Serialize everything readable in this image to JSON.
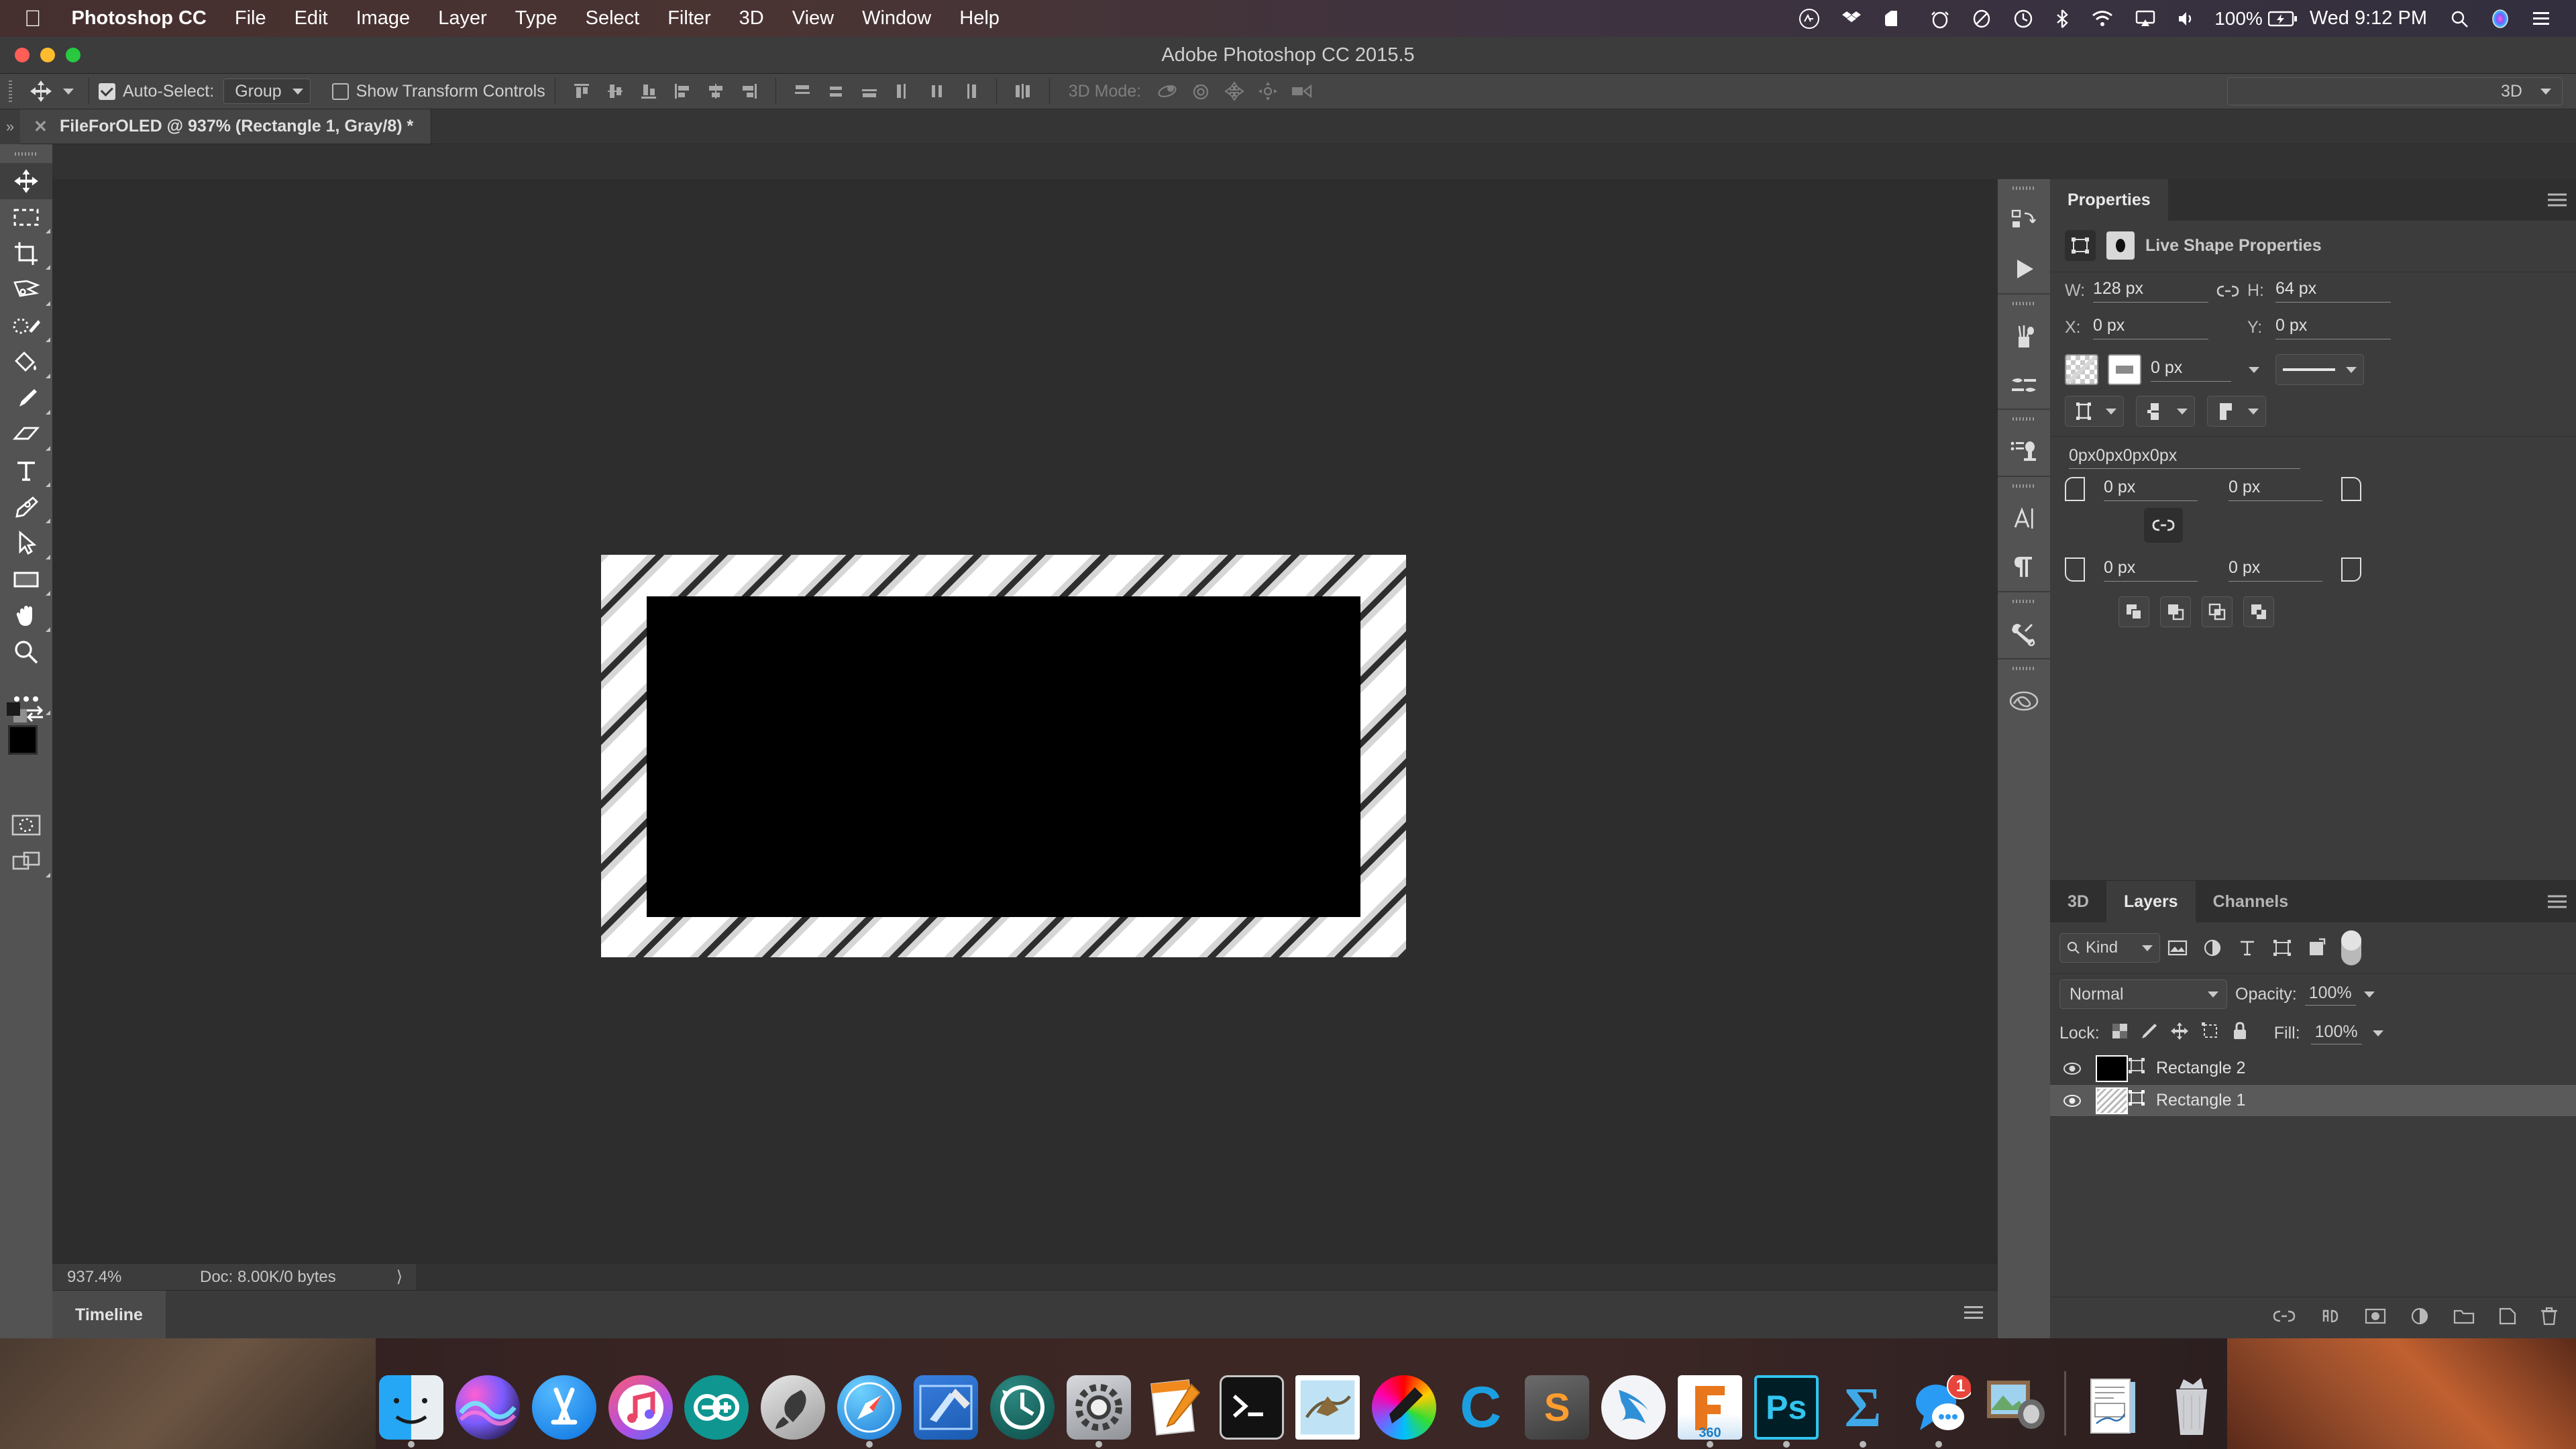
{
  "menubar": {
    "apple_icon": "apple-icon",
    "app_name": "Photoshop CC",
    "items": [
      "File",
      "Edit",
      "Image",
      "Layer",
      "Type",
      "Select",
      "Filter",
      "3D",
      "View",
      "Window",
      "Help"
    ],
    "status": {
      "creative_cloud": "creative-cloud-icon",
      "dropbox": "dropbox-icon",
      "evernote": "evernote-icon",
      "alarm": "alarm-icon",
      "backblaze": "backblaze-icon",
      "timemachine": "time-machine-icon",
      "bluetooth": "bluetooth-icon",
      "wifi": "wifi-icon",
      "airplay": "airplay-icon",
      "volume": "volume-icon",
      "battery_percent": "100%",
      "battery": "battery-charging-icon",
      "datetime": "Wed 9:12 PM",
      "spotlight": "search-icon",
      "siri": "siri-icon",
      "notification_center": "notification-center-icon"
    }
  },
  "window": {
    "title": "Adobe Photoshop CC 2015.5"
  },
  "options_bar": {
    "move_tool_icon": "move-tool-icon",
    "auto_select_label": "Auto-Select:",
    "auto_select_checked": true,
    "auto_select_value": "Group",
    "show_transform_label": "Show Transform Controls",
    "show_transform_checked": false,
    "align_icons": [
      "align-top-edges-icon",
      "align-vertical-centers-icon",
      "align-bottom-edges-icon",
      "align-left-edges-icon",
      "align-horizontal-centers-icon",
      "align-right-edges-icon"
    ],
    "distribute_icons": [
      "distribute-top-edges-icon",
      "distribute-vertical-centers-icon",
      "distribute-bottom-edges-icon",
      "distribute-left-edges-icon",
      "distribute-horizontal-centers-icon",
      "distribute-right-edges-icon"
    ],
    "extra_icon": "align-extra-icon",
    "mode3d_label": "3D Mode:",
    "mode3d_icons": [
      "rotate-3d-icon",
      "roll-3d-icon",
      "drag-3d-icon",
      "slide-3d-icon",
      "scale-3d-icon"
    ],
    "workspace": "3D"
  },
  "document_tab": {
    "close_icon": "close-icon",
    "title": "FileForOLED @ 937% (Rectangle 1, Gray/8) *"
  },
  "toolbar": {
    "tools": [
      {
        "name": "move-tool",
        "icon": "move-tool-icon",
        "selected": true,
        "has_flyout": false
      },
      {
        "name": "rectangular-marquee-tool",
        "icon": "marquee-icon",
        "selected": false,
        "has_flyout": true
      },
      {
        "name": "crop-tool",
        "icon": "crop-icon",
        "selected": false,
        "has_flyout": true
      },
      {
        "name": "lasso-tool",
        "icon": "lasso-icon",
        "selected": false,
        "has_flyout": true
      },
      {
        "name": "quick-selection-tool",
        "icon": "quick-select-icon",
        "selected": false,
        "has_flyout": true
      },
      {
        "name": "paint-bucket-tool",
        "icon": "paint-bucket-icon",
        "selected": false,
        "has_flyout": true
      },
      {
        "name": "brush-tool",
        "icon": "brush-icon",
        "selected": false,
        "has_flyout": true
      },
      {
        "name": "eraser-tool",
        "icon": "eraser-icon",
        "selected": false,
        "has_flyout": true
      },
      {
        "name": "type-tool",
        "icon": "type-icon",
        "selected": false,
        "has_flyout": true
      },
      {
        "name": "pen-tool",
        "icon": "pen-icon",
        "selected": false,
        "has_flyout": true
      },
      {
        "name": "path-selection-tool",
        "icon": "path-select-icon",
        "selected": false,
        "has_flyout": true
      },
      {
        "name": "rectangle-tool",
        "icon": "rectangle-icon",
        "selected": false,
        "has_flyout": true
      },
      {
        "name": "hand-tool",
        "icon": "hand-icon",
        "selected": false,
        "has_flyout": true
      },
      {
        "name": "zoom-tool",
        "icon": "zoom-icon",
        "selected": false,
        "has_flyout": false
      },
      {
        "name": "edit-toolbar",
        "icon": "ellipsis-icon",
        "selected": false,
        "has_flyout": true
      }
    ],
    "foreground_color": "#000000",
    "background_color": "#ffffff",
    "default-colors-icon": "default-colors-icon",
    "swap-colors-icon": "swap-colors-icon",
    "quick-mask-icon": "quick-mask-icon",
    "screen-mode-icon": "screen-mode-icon"
  },
  "canvas": {
    "zoom": "937.4%",
    "doc_info": "Doc: 8.00K/0 bytes",
    "expand_icon": "chevron-right-icon",
    "pattern": "diagonal-stripe-pattern",
    "shape_color": "#000000"
  },
  "timeline": {
    "tab_label": "Timeline",
    "menu_icon": "panel-menu-icon"
  },
  "icon_rail": {
    "groups": [
      [
        "history-panel-icon",
        "actions-panel-icon"
      ],
      [
        "brushes-panel-icon",
        "brush-settings-panel-icon"
      ],
      [
        "clone-source-panel-icon"
      ],
      [
        "character-panel-icon",
        "paragraph-panel-icon"
      ],
      [
        "tool-presets-panel-icon"
      ],
      [
        "cc-libraries-panel-icon"
      ]
    ]
  },
  "properties": {
    "tab_label": "Properties",
    "menu_icon": "panel-menu-icon",
    "shape_icon": "live-shape-icon",
    "mask_icon": "mask-thumbnail-icon",
    "heading": "Live Shape Properties",
    "w_label": "W:",
    "w_value": "128 px",
    "link_icon": "link-icon",
    "h_label": "H:",
    "h_value": "64 px",
    "x_label": "X:",
    "x_value": "0 px",
    "y_label": "Y:",
    "y_value": "0 px",
    "fill_swatch": "no-fill-swatch",
    "stroke_swatch": "white-stroke-swatch",
    "stroke_width": "0 px",
    "stroke_style_icon": "stroke-style-icon",
    "stroke_align_icon": "stroke-align-icon",
    "stroke_cap_icon": "stroke-cap-icon",
    "stroke_corner_icon": "stroke-corner-icon",
    "radius_summary": "0px0px0px0px",
    "radius_tl": "0 px",
    "radius_tr": "0 px",
    "radius_bl": "0 px",
    "radius_br": "0 px",
    "radius_link_icon": "link-icon",
    "path_ops": [
      "combine-shapes-icon",
      "subtract-front-shape-icon",
      "intersect-shapes-icon",
      "exclude-overlap-icon"
    ]
  },
  "layers": {
    "tabs": [
      {
        "label": "3D",
        "active": false
      },
      {
        "label": "Layers",
        "active": true
      },
      {
        "label": "Channels",
        "active": false
      }
    ],
    "menu_icon": "panel-menu-icon",
    "filter_label": "Kind",
    "filter_icons": [
      "filter-pixel-icon",
      "filter-adjustment-icon",
      "filter-type-icon",
      "filter-shape-icon",
      "filter-smart-object-icon"
    ],
    "filter_toggle": "filter-enable-toggle",
    "blend_mode": "Normal",
    "opacity_label": "Opacity:",
    "opacity_value": "100%",
    "lock_label": "Lock:",
    "lock_icons": [
      "lock-transparent-pixels-icon",
      "lock-image-pixels-icon",
      "lock-position-icon",
      "lock-artboard-icon",
      "lock-all-icon"
    ],
    "fill_label": "Fill:",
    "fill_value": "100%",
    "rows": [
      {
        "name": "Rectangle 2",
        "visible": true,
        "selected": false,
        "thumb": "black"
      },
      {
        "name": "Rectangle 1",
        "visible": true,
        "selected": true,
        "thumb": "hatch"
      }
    ],
    "footer_icons": [
      "link-layers-icon",
      "layer-style-icon",
      "layer-mask-icon",
      "adjustment-layer-icon",
      "new-group-icon",
      "new-layer-icon",
      "delete-layer-icon"
    ]
  },
  "dock": {
    "items": [
      {
        "name": "finder",
        "label": "Finder",
        "running": true
      },
      {
        "name": "siri",
        "label": "Siri",
        "running": false
      },
      {
        "name": "app-store",
        "label": "App Store",
        "running": false
      },
      {
        "name": "itunes",
        "label": "iTunes",
        "running": false
      },
      {
        "name": "arduino",
        "label": "Arduino",
        "running": false
      },
      {
        "name": "launchpad",
        "label": "Launchpad",
        "running": false
      },
      {
        "name": "safari",
        "label": "Safari",
        "running": true
      },
      {
        "name": "xcode",
        "label": "Xcode",
        "running": false
      },
      {
        "name": "time-machine",
        "label": "Time Machine",
        "running": false
      },
      {
        "name": "system-preferences",
        "label": "System Preferences",
        "running": true
      },
      {
        "name": "pages",
        "label": "Pages",
        "running": false
      },
      {
        "name": "terminal",
        "label": "Terminal",
        "running": false
      },
      {
        "name": "mail",
        "label": "Mail",
        "running": false
      },
      {
        "name": "digital-color-meter",
        "label": "Digital Color Meter",
        "running": false
      },
      {
        "name": "cura",
        "label": "C",
        "running": false
      },
      {
        "name": "sublime-text",
        "label": "S",
        "running": false
      },
      {
        "name": "swift",
        "label": "Swift",
        "running": false
      },
      {
        "name": "fusion-360",
        "label": "360",
        "running": true
      },
      {
        "name": "photoshop",
        "label": "Ps",
        "running": true
      },
      {
        "name": "latex",
        "label": "LaTeX",
        "running": true
      },
      {
        "name": "messages",
        "label": "Messages",
        "badge": "1",
        "running": true
      },
      {
        "name": "preview",
        "label": "Preview",
        "running": false
      },
      {
        "name": "documents-stack",
        "label": "Documents",
        "running": false
      },
      {
        "name": "trash",
        "label": "Trash",
        "running": false
      }
    ]
  }
}
